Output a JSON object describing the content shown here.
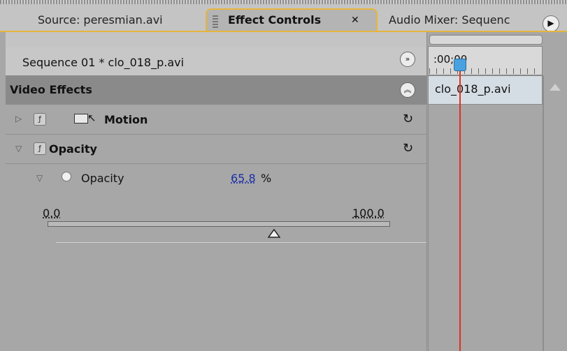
{
  "tabs": {
    "source": "Source: peresmian.avi",
    "effect_controls": "Effect Controls",
    "effect_controls_close": "✕",
    "audio_mixer": "Audio Mixer: Sequenc"
  },
  "panel": {
    "sequence_label": "Sequence 01 * clo_018_p.avi",
    "video_effects_label": "Video Effects"
  },
  "effects": [
    {
      "name": "Motion",
      "expanded": false
    },
    {
      "name": "Opacity",
      "expanded": true
    }
  ],
  "opacity_param": {
    "label": "Opacity",
    "value": "65.8",
    "unit": "%",
    "slider_min": "0.0",
    "slider_max": "100.0",
    "slider_fraction": 0.658
  },
  "timeline": {
    "timecode": ":00;00",
    "clip_name": "clo_018_p.avi"
  },
  "colors": {
    "accent": "#e7b53c",
    "playhead": "#e2301f",
    "value_link": "#1a2fa8"
  }
}
